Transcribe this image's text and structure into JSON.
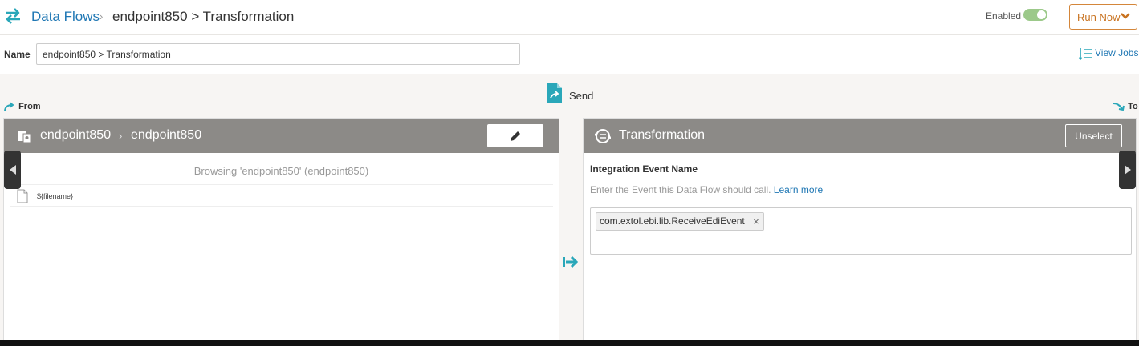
{
  "header": {
    "breadcrumb_root": "Data Flows",
    "breadcrumb_current": "endpoint850 > Transformation",
    "enabled_label": "Enabled",
    "enabled": true,
    "run_now_label": "Run Now",
    "logo_icon": "swap-arrows-icon"
  },
  "name_row": {
    "label": "Name",
    "value": "endpoint850 > Transformation",
    "view_jobs_label": "View Jobs"
  },
  "flow": {
    "send_label": "Send",
    "from_label": "From",
    "to_label": "To"
  },
  "source_panel": {
    "endpoint": "endpoint850",
    "sub_endpoint": "endpoint850",
    "browsing_text": "Browsing 'endpoint850' (endpoint850)",
    "files": [
      {
        "name": "${filename}"
      }
    ]
  },
  "target_panel": {
    "title": "Transformation",
    "unselect_label": "Unselect",
    "field_label": "Integration Event Name",
    "help_text": "Enter the Event this Data Flow should call.",
    "learn_more": "Learn more",
    "tags": [
      {
        "value": "com.extol.ebi.lib.ReceiveEdiEvent"
      }
    ]
  },
  "colors": {
    "accent_teal": "#2aa7b9",
    "link_blue": "#1f77b4",
    "run_orange": "#c8721f",
    "panel_header": "#8c8a87"
  }
}
